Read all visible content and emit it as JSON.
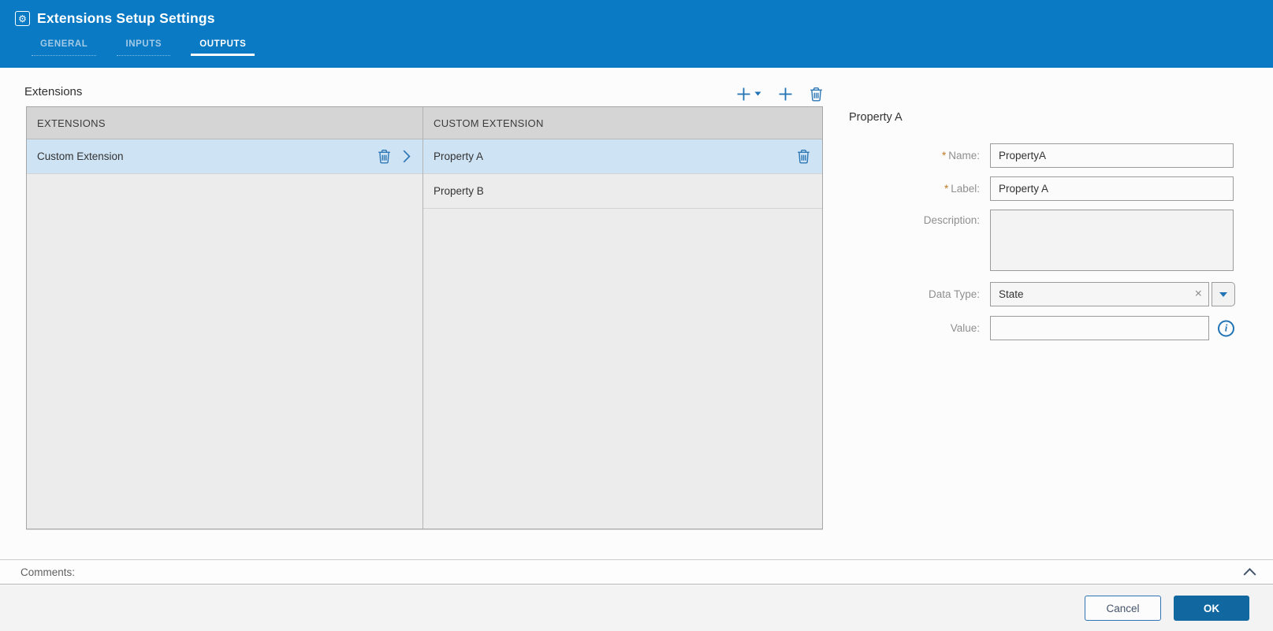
{
  "header": {
    "title": "Extensions Setup Settings",
    "tabs": [
      {
        "label": "GENERAL",
        "active": false
      },
      {
        "label": "INPUTS",
        "active": false
      },
      {
        "label": "OUTPUTS",
        "active": true
      }
    ]
  },
  "extensions": {
    "section_title": "Extensions",
    "list": {
      "header": "EXTENSIONS",
      "rows": [
        {
          "label": "Custom Extension",
          "selected": true
        }
      ]
    },
    "sublist": {
      "header": "CUSTOM EXTENSION",
      "rows": [
        {
          "label": "Property A",
          "selected": true
        },
        {
          "label": "Property B",
          "selected": false
        }
      ]
    }
  },
  "form": {
    "title": "Property A",
    "required_marker": "*",
    "fields": {
      "name": {
        "label": "Name:",
        "required": true,
        "value": "PropertyA"
      },
      "label": {
        "label": "Label:",
        "required": true,
        "value": "Property A"
      },
      "description": {
        "label": "Description:",
        "required": false,
        "value": ""
      },
      "data_type": {
        "label": "Data Type:",
        "required": false,
        "value": "State"
      },
      "value": {
        "label": "Value:",
        "required": false,
        "value": ""
      }
    },
    "clear_glyph": "×"
  },
  "comments": {
    "label": "Comments:"
  },
  "footer": {
    "cancel_label": "Cancel",
    "ok_label": "OK"
  },
  "icons": {
    "title": "gear-icon",
    "toolbar": [
      "add-dropdown-icon",
      "add-icon",
      "trash-icon"
    ],
    "extension_row": [
      "trash-icon",
      "chevron-right-icon"
    ],
    "property_row": [
      "trash-icon"
    ],
    "data_type_field": [
      "x-clear-icon",
      "caret-down-icon"
    ],
    "value_field": [
      "info-icon"
    ],
    "comments": [
      "chevron-up-icon"
    ]
  },
  "colors": {
    "header_blue": "#0a7ac4",
    "accent_blue": "#2173b5",
    "selected_row": "#cee3f4",
    "ok_button": "#1168a0",
    "required_asterisk": "#bf7a28",
    "panel_header_gray": "#d5d5d5",
    "panel_body_gray": "#ececec"
  }
}
